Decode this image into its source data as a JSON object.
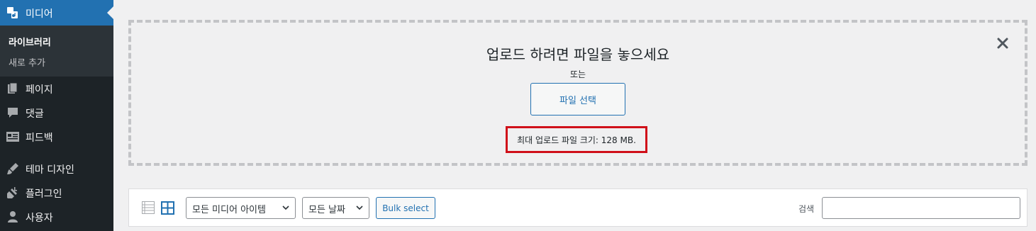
{
  "sidebar": {
    "active_menu": {
      "label": "미디어",
      "icon": "media-icon"
    },
    "submenu": [
      {
        "label": "라이브러리",
        "current": true
      },
      {
        "label": "새로 추가",
        "current": false
      }
    ],
    "items": [
      {
        "label": "페이지",
        "icon": "pages-icon"
      },
      {
        "label": "댓글",
        "icon": "comments-icon"
      },
      {
        "label": "피드백",
        "icon": "feedback-icon"
      },
      {
        "label": "테마 디자인",
        "icon": "brush-icon"
      },
      {
        "label": "플러그인",
        "icon": "plugin-icon"
      },
      {
        "label": "사용자",
        "icon": "users-icon"
      }
    ]
  },
  "uploader": {
    "title": "업로드 하려면 파일을 놓으세요",
    "or_text": "또는",
    "select_button": "파일 선택",
    "max_size": "최대 업로드 파일 크기: 128 MB."
  },
  "toolbar": {
    "media_type_filter": "모든 미디어 아이템",
    "date_filter": "모든 날짜",
    "bulk_select": "Bulk select",
    "search_label": "검색",
    "search_value": ""
  },
  "colors": {
    "sidebar_bg": "#1d2327",
    "active_menu_bg": "#2271b1",
    "highlight_border": "#d0101a"
  }
}
